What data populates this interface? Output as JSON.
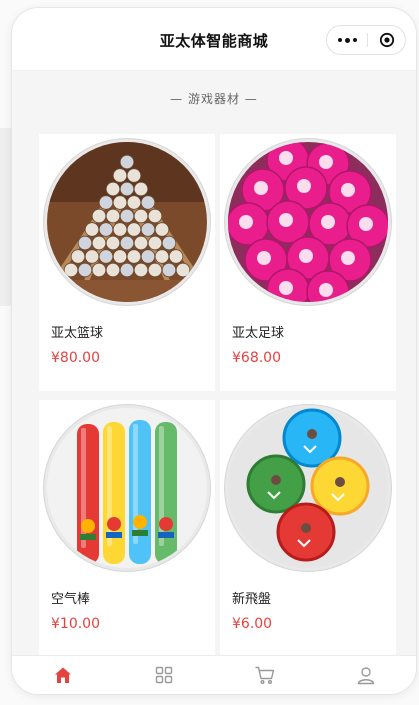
{
  "navbar": {
    "title": "亚太体智能商城",
    "more_icon": "more-dots-icon",
    "close_icon": "target-circle-icon"
  },
  "section": {
    "title": "— 游戏器材 —"
  },
  "products": [
    {
      "name": "亚太篮球",
      "price": "¥80.00",
      "image": "basketball-pyramid"
    },
    {
      "name": "亚太足球",
      "price": "¥68.00",
      "image": "pink-footballs"
    },
    {
      "name": "空气棒",
      "price": "¥10.00",
      "image": "inflatable-sticks"
    },
    {
      "name": "新飛盤",
      "price": "¥6.00",
      "image": "frisbees"
    }
  ],
  "tabbar": {
    "tabs": [
      {
        "icon": "home-icon",
        "active": true
      },
      {
        "icon": "category-grid-icon",
        "active": false
      },
      {
        "icon": "cart-icon",
        "active": false
      },
      {
        "icon": "user-icon",
        "active": false
      }
    ],
    "active_color": "#e64340",
    "inactive_color": "#999999"
  },
  "colors": {
    "price": "#e64340",
    "accent": "#e64340"
  }
}
